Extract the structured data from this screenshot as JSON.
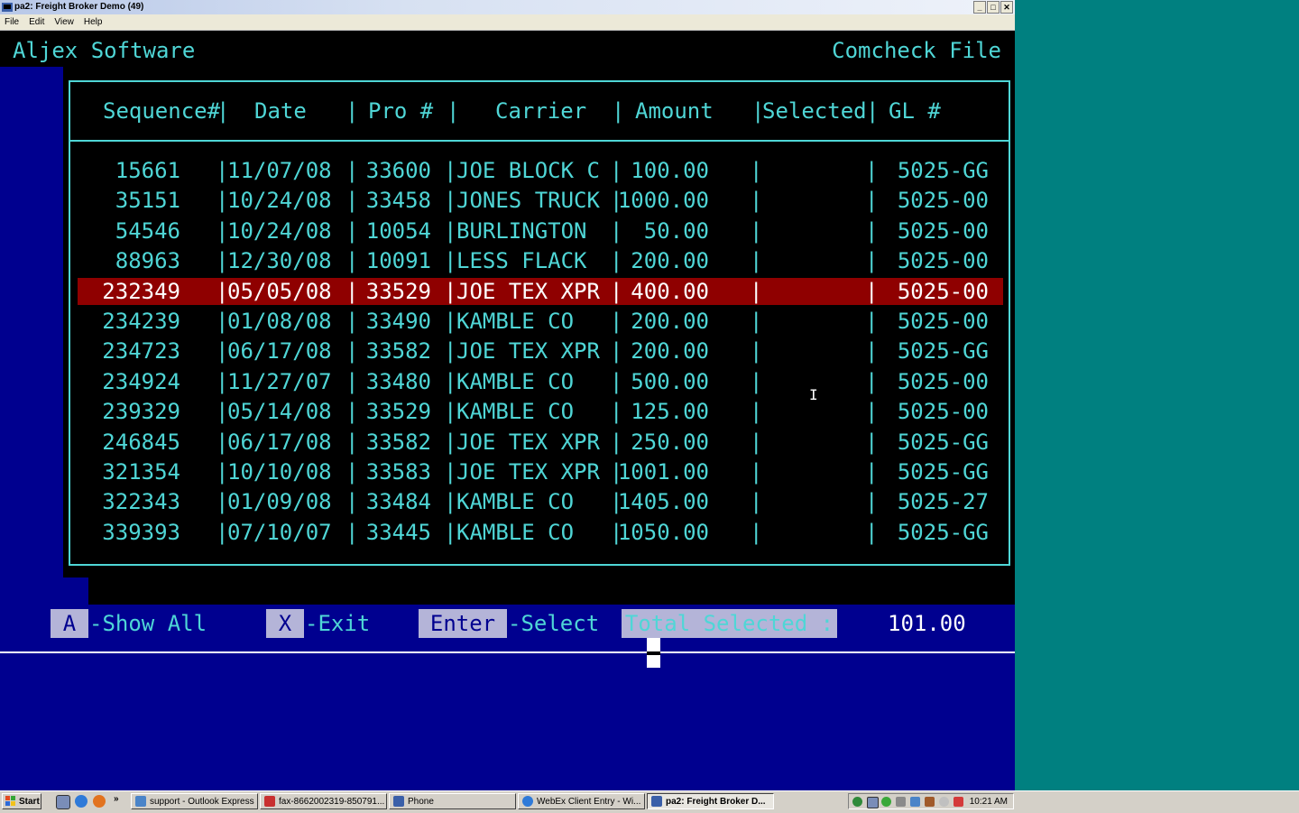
{
  "window": {
    "title": "pa2: Freight Broker Demo (49)",
    "menu": [
      "File",
      "Edit",
      "View",
      "Help"
    ],
    "buttons": {
      "minimize": "_",
      "maximize": "□",
      "close": "✕"
    }
  },
  "terminal": {
    "app_title": "Aljex Software",
    "screen_title": "Comcheck File",
    "columns": [
      "Sequence#",
      "Date",
      "Pro #",
      "Carrier",
      "Amount",
      "Selected",
      "GL #"
    ],
    "rows": [
      {
        "seq": "15661",
        "date": "11/07/08",
        "pro": "33600",
        "carrier": "JOE BLOCK C",
        "amount": "100.00",
        "selected": "",
        "gl": "5025-GG"
      },
      {
        "seq": "35151",
        "date": "10/24/08",
        "pro": "33458",
        "carrier": "JONES TRUCK",
        "amount": "1000.00",
        "selected": "",
        "gl": "5025-00"
      },
      {
        "seq": "54546",
        "date": "10/24/08",
        "pro": "10054",
        "carrier": "BURLINGTON",
        "amount": "50.00",
        "selected": "",
        "gl": "5025-00"
      },
      {
        "seq": "88963",
        "date": "12/30/08",
        "pro": "10091",
        "carrier": "LESS FLACK",
        "amount": "200.00",
        "selected": "",
        "gl": "5025-00"
      },
      {
        "seq": "232349",
        "date": "05/05/08",
        "pro": "33529",
        "carrier": "JOE TEX XPR",
        "amount": "400.00",
        "selected": "",
        "gl": "5025-00"
      },
      {
        "seq": "234239",
        "date": "01/08/08",
        "pro": "33490",
        "carrier": "KAMBLE CO",
        "amount": "200.00",
        "selected": "",
        "gl": "5025-00"
      },
      {
        "seq": "234723",
        "date": "06/17/08",
        "pro": "33582",
        "carrier": "JOE TEX XPR",
        "amount": "200.00",
        "selected": "",
        "gl": "5025-GG"
      },
      {
        "seq": "234924",
        "date": "11/27/07",
        "pro": "33480",
        "carrier": "KAMBLE CO",
        "amount": "500.00",
        "selected": "",
        "gl": "5025-00"
      },
      {
        "seq": "239329",
        "date": "05/14/08",
        "pro": "33529",
        "carrier": "KAMBLE CO",
        "amount": "125.00",
        "selected": "",
        "gl": "5025-00"
      },
      {
        "seq": "246845",
        "date": "06/17/08",
        "pro": "33582",
        "carrier": "JOE TEX XPR",
        "amount": "250.00",
        "selected": "",
        "gl": "5025-GG"
      },
      {
        "seq": "321354",
        "date": "10/10/08",
        "pro": "33583",
        "carrier": "JOE TEX XPR",
        "amount": "1001.00",
        "selected": "",
        "gl": "5025-GG"
      },
      {
        "seq": "322343",
        "date": "01/09/08",
        "pro": "33484",
        "carrier": "KAMBLE CO",
        "amount": "1405.00",
        "selected": "",
        "gl": "5025-27"
      },
      {
        "seq": "339393",
        "date": "07/10/07",
        "pro": "33445",
        "carrier": "KAMBLE CO",
        "amount": "1050.00",
        "selected": "",
        "gl": "5025-GG"
      }
    ],
    "highlighted_row_index": 4,
    "function_keys": [
      {
        "key": "A",
        "label": "-Show All"
      },
      {
        "key": "X",
        "label": "-Exit"
      },
      {
        "key": "Enter",
        "label": "-Select"
      }
    ],
    "total_label": "Total Selected :",
    "total_value": "101.00"
  },
  "taskbar": {
    "start_label": "Start",
    "overflow": "»",
    "buttons": [
      {
        "label": "support - Outlook Express",
        "icon": "outlook-icon",
        "active": false
      },
      {
        "label": "fax-8662002319-850791...",
        "icon": "pdf-icon",
        "active": false
      },
      {
        "label": "Phone",
        "icon": "phone-icon",
        "active": false
      },
      {
        "label": "WebEx Client Entry - Wi...",
        "icon": "browser-icon",
        "active": false
      },
      {
        "label": "pa2: Freight Broker D...",
        "icon": "terminal-icon",
        "active": true
      }
    ],
    "clock": "10:21 AM"
  },
  "colors": {
    "terminal_text": "#4fd6d6",
    "terminal_bg": "#000000",
    "panel_blue": "#00008f",
    "highlight_red": "#8f0000",
    "desktop": "#008080"
  }
}
